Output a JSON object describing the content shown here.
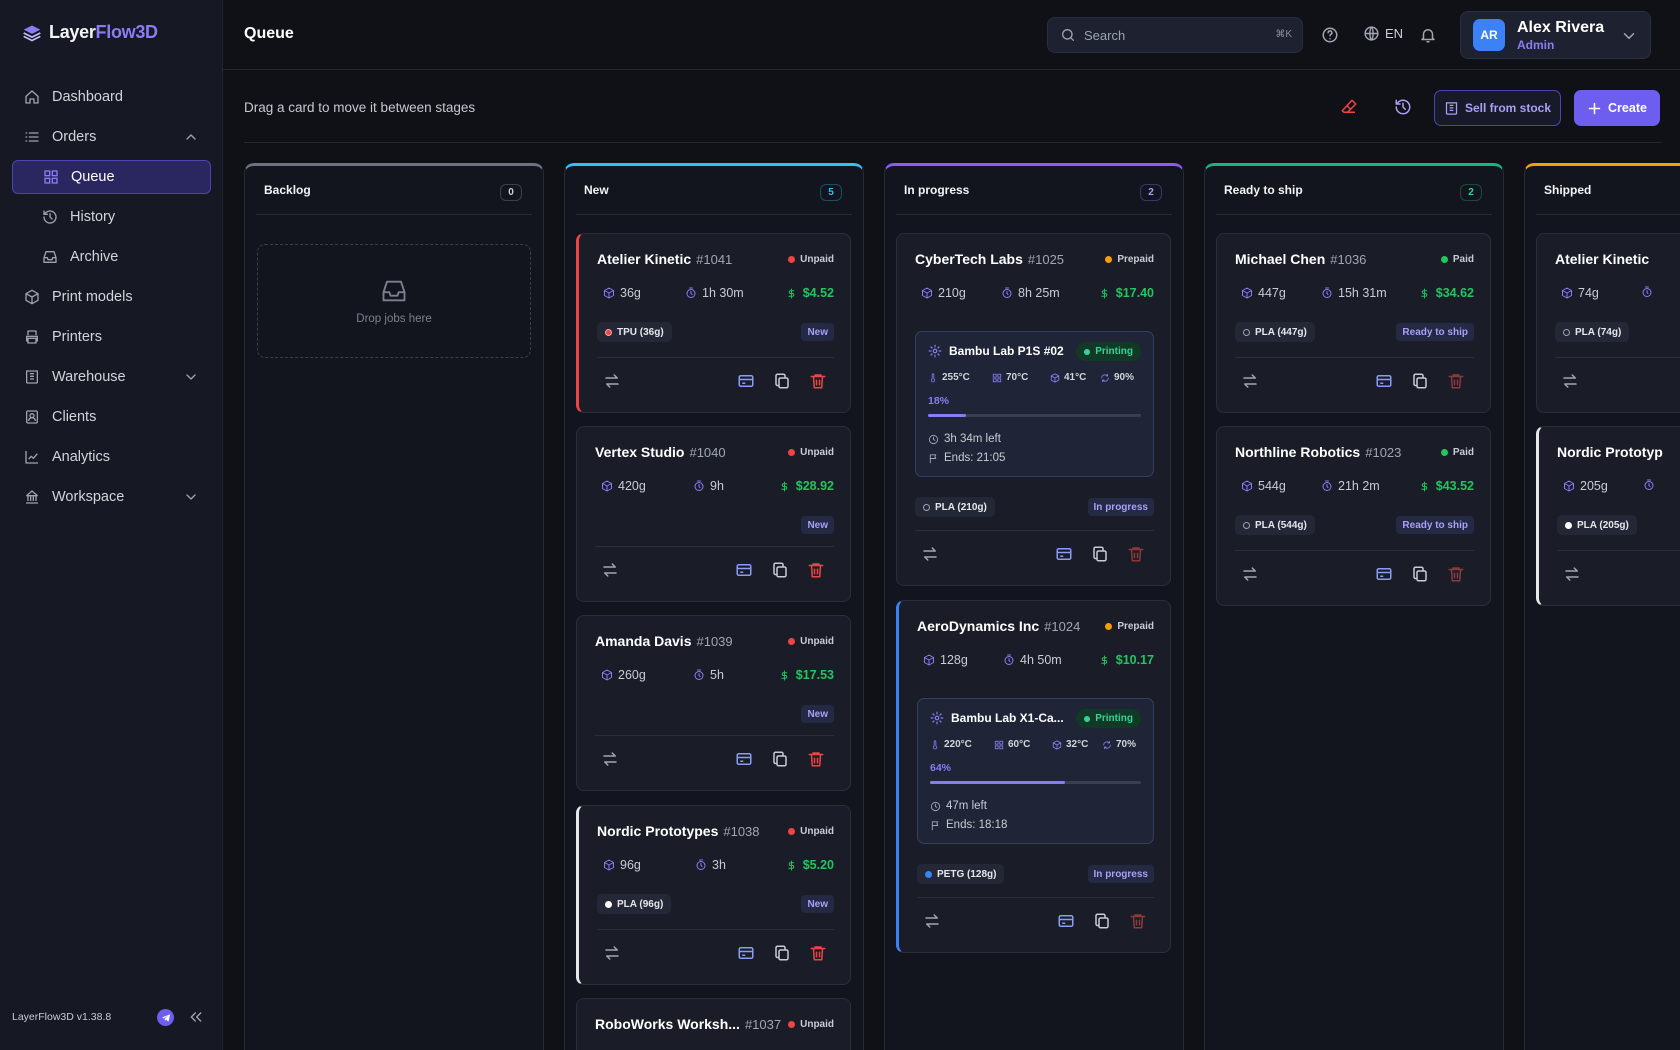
{
  "app": {
    "name_a": "Layer",
    "name_b": "Flow3D",
    "version": "LayerFlow3D v1.38.8"
  },
  "sidebar": {
    "items": [
      {
        "label": "Dashboard",
        "icon": "home-icon"
      },
      {
        "label": "Orders",
        "icon": "list-icon",
        "expanded": true
      },
      {
        "label": "Queue",
        "icon": "grid-icon",
        "active": true
      },
      {
        "label": "History",
        "icon": "history-icon"
      },
      {
        "label": "Archive",
        "icon": "inbox-icon"
      },
      {
        "label": "Print models",
        "icon": "cube-icon"
      },
      {
        "label": "Printers",
        "icon": "printer-icon"
      },
      {
        "label": "Warehouse",
        "icon": "warehouse-icon"
      },
      {
        "label": "Clients",
        "icon": "contacts-icon"
      },
      {
        "label": "Analytics",
        "icon": "chart-icon"
      },
      {
        "label": "Workspace",
        "icon": "building-icon"
      }
    ]
  },
  "header": {
    "title": "Queue",
    "search_placeholder": "Search",
    "search_shortcut": "⌘K",
    "language": "EN",
    "user": {
      "initials": "AR",
      "name": "Alex Rivera",
      "role": "Admin"
    }
  },
  "toolbar": {
    "hint": "Drag a card to move it between stages",
    "sell_label": "Sell from stock",
    "create_label": "Create"
  },
  "colors": {
    "accent": "#6d5ef0",
    "backlog": "#6b7280",
    "new": "#38bdf8",
    "in_progress": "#8b5cf6",
    "ready": "#10b981",
    "shipped": "#f59e0b",
    "unpaid": "#ef4444",
    "prepaid": "#f59e0b",
    "paid": "#22c55e"
  },
  "columns": [
    {
      "title": "Backlog",
      "count": "0",
      "drop_text": "Drop jobs here"
    },
    {
      "title": "New",
      "count": "5"
    },
    {
      "title": "In progress",
      "count": "2"
    },
    {
      "title": "Ready to ship",
      "count": "2"
    },
    {
      "title": "Shipped",
      "count": ""
    }
  ],
  "cards": {
    "c1041": {
      "client": "Atelier Kinetic",
      "num": "#1041",
      "pay": "Unpaid",
      "weight": "36g",
      "time": "1h 30m",
      "price": "$4.52",
      "material": "TPU (36g)",
      "stage": "New"
    },
    "c1040": {
      "client": "Vertex Studio",
      "num": "#1040",
      "pay": "Unpaid",
      "weight": "420g",
      "time": "9h",
      "price": "$28.92",
      "stage": "New"
    },
    "c1039": {
      "client": "Amanda Davis",
      "num": "#1039",
      "pay": "Unpaid",
      "weight": "260g",
      "time": "5h",
      "price": "$17.53",
      "stage": "New"
    },
    "c1038": {
      "client": "Nordic Prototypes",
      "num": "#1038",
      "pay": "Unpaid",
      "weight": "96g",
      "time": "3h",
      "price": "$5.20",
      "material": "PLA (96g)",
      "stage": "New"
    },
    "c1037": {
      "client": "RoboWorks Worksh...",
      "num": "#1037",
      "pay": "Unpaid"
    },
    "c1025": {
      "client": "CyberTech Labs",
      "num": "#1025",
      "pay": "Prepaid",
      "weight": "210g",
      "time": "8h 25m",
      "price": "$17.40",
      "material": "PLA (210g)",
      "stage": "In progress",
      "printer": {
        "name": "Bambu Lab P1S #02",
        "status": "Printing",
        "nozzle": "255°C",
        "bed": "70°C",
        "chamber": "41°C",
        "fan": "90%",
        "progress": "18%",
        "left": "3h 34m left",
        "ends": "Ends: 21:05"
      }
    },
    "c1024": {
      "client": "AeroDynamics Inc",
      "num": "#1024",
      "pay": "Prepaid",
      "weight": "128g",
      "time": "4h 50m",
      "price": "$10.17",
      "material": "PETG (128g)",
      "stage": "In progress",
      "printer": {
        "name": "Bambu Lab X1-Ca...",
        "status": "Printing",
        "nozzle": "220°C",
        "bed": "60°C",
        "chamber": "32°C",
        "fan": "70%",
        "progress": "64%",
        "left": "47m left",
        "ends": "Ends: 18:18"
      }
    },
    "c1036": {
      "client": "Michael Chen",
      "num": "#1036",
      "pay": "Paid",
      "weight": "447g",
      "time": "15h 31m",
      "price": "$34.62",
      "material": "PLA (447g)",
      "stage": "Ready to ship"
    },
    "c1023": {
      "client": "Northline Robotics",
      "num": "#1023",
      "pay": "Paid",
      "weight": "544g",
      "time": "21h 2m",
      "price": "$43.52",
      "material": "PLA (544g)",
      "stage": "Ready to ship"
    },
    "s1": {
      "client": "Atelier Kinetic",
      "weight": "74g",
      "material": "PLA (74g)"
    },
    "s2": {
      "client": "Nordic Prototyp",
      "weight": "205g",
      "material": "PLA (205g)"
    }
  }
}
